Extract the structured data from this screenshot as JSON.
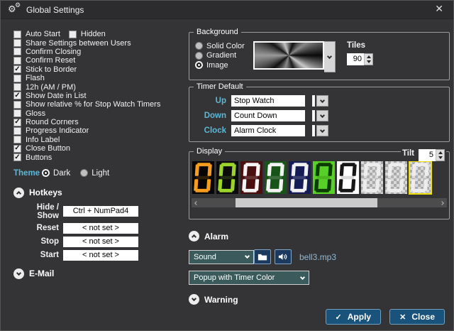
{
  "window": {
    "title": "Global Settings"
  },
  "icons": {
    "gear": "⚙",
    "titlebar_close": "✕",
    "apply": "✓",
    "close": "✕"
  },
  "left": {
    "checkbox_rows": [
      [
        {
          "label": "Auto Start",
          "checked": false
        },
        {
          "label": "Hidden",
          "checked": false
        }
      ],
      [
        {
          "label": "Share Settings between Users",
          "checked": false
        }
      ],
      [
        {
          "label": "Confirm Closing",
          "checked": false
        }
      ],
      [
        {
          "label": "Confirm Reset",
          "checked": false
        }
      ],
      [
        {
          "label": "Stick to Border",
          "checked": true
        }
      ],
      [
        {
          "label": "Flash",
          "checked": false
        }
      ],
      [
        {
          "label": "12h (AM / PM)",
          "checked": false
        }
      ],
      [
        {
          "label": "Show Date in List",
          "checked": true
        }
      ],
      [
        {
          "label": "Show relative % for Stop Watch Timers",
          "checked": false
        }
      ],
      [
        {
          "label": "Gloss",
          "checked": false
        }
      ],
      [
        {
          "label": "Round Corners",
          "checked": true
        }
      ],
      [
        {
          "label": "Progress Indicator",
          "checked": false
        }
      ],
      [
        {
          "label": "Info Label",
          "checked": false
        }
      ],
      [
        {
          "label": "Close Button",
          "checked": true
        }
      ],
      [
        {
          "label": "Buttons",
          "checked": true
        }
      ]
    ],
    "theme": {
      "label": "Theme",
      "options": [
        {
          "label": "Dark",
          "selected": true
        },
        {
          "label": "Light",
          "selected": false
        }
      ]
    },
    "hotkeys": {
      "header": "Hotkeys",
      "rows": [
        {
          "label": "Hide / Show",
          "value": "Ctrl + NumPad4"
        },
        {
          "label": "Reset",
          "value": "< not set >"
        },
        {
          "label": "Stop",
          "value": "< not set >"
        },
        {
          "label": "Start",
          "value": "< not set >"
        }
      ]
    },
    "email": {
      "header": "E-Mail"
    }
  },
  "background": {
    "title": "Background",
    "options": [
      {
        "label": "Solid Color",
        "selected": false
      },
      {
        "label": "Gradient",
        "selected": false
      },
      {
        "label": "Image",
        "selected": true
      }
    ],
    "tiles_label": "Tiles",
    "tiles_value": "90"
  },
  "timer_default": {
    "title": "Timer Default",
    "rows": [
      {
        "label": "Up",
        "value": "Stop Watch",
        "color": "#a5542b"
      },
      {
        "label": "Down",
        "value": "Count Down",
        "color": "#6a5bd0"
      },
      {
        "label": "Clock",
        "value": "Alarm Clock",
        "color": "#8fe02c"
      }
    ]
  },
  "display": {
    "title": "Display",
    "tilt_label": "Tilt",
    "tilt_value": "5",
    "digit": "0",
    "tiles": [
      {
        "bg": "#060606",
        "fg": "#f79d1e",
        "checker": false,
        "selected": false
      },
      {
        "bg": "#0b0b0b",
        "fg": "#9cd42c",
        "checker": false,
        "selected": false
      },
      {
        "bg": "#4a0f0f",
        "fg": "#f4f4f4",
        "checker": false,
        "selected": false
      },
      {
        "bg": "#175418",
        "fg": "#f2f2f2",
        "checker": false,
        "selected": false
      },
      {
        "bg": "#141b55",
        "fg": "#f0f0f0",
        "checker": false,
        "selected": false
      },
      {
        "bg": "#57d028",
        "fg": "#0d3d02",
        "checker": false,
        "selected": false
      },
      {
        "bg": "#ffffff",
        "fg": "#161616",
        "checker": false,
        "selected": false
      },
      {
        "bg": "",
        "fg": "#ededed",
        "checker": true,
        "selected": false
      },
      {
        "bg": "",
        "fg": "#ededed",
        "checker": true,
        "selected": false
      },
      {
        "bg": "",
        "fg": "#ededed",
        "checker": true,
        "selected": true
      }
    ]
  },
  "alarm": {
    "header": "Alarm",
    "sound_value": "Sound",
    "file": "bell3.mp3",
    "popup_value": "Popup with Timer Color"
  },
  "warning": {
    "header": "Warning"
  },
  "footer": {
    "apply": "Apply",
    "close": "Close"
  },
  "colors": {
    "accent_cyan": "#5cb8d6",
    "button_blue": "#19527b",
    "selection_yellow": "#efdf0c",
    "link_blue": "#8fb7d2"
  }
}
